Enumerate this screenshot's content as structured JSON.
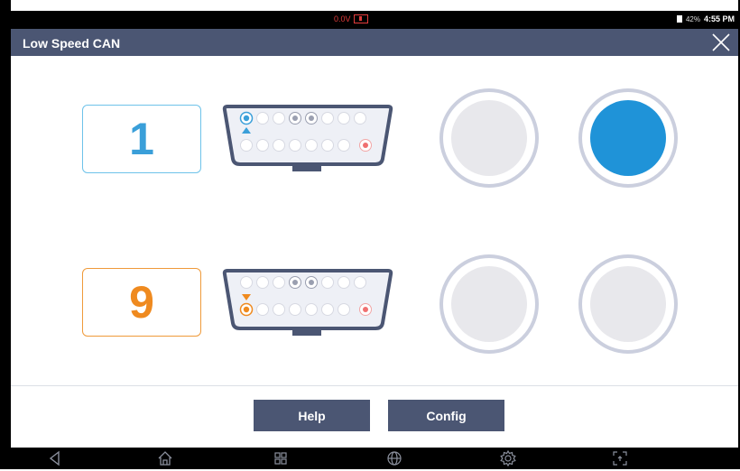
{
  "status_bar": {
    "voltage": "0.0V",
    "battery_percent": "42%",
    "time": "4:55 PM"
  },
  "title_bar": {
    "title": "Low Speed CAN"
  },
  "channels": [
    {
      "pin": "1",
      "color": "#3a9fd9",
      "active_led": "#1f93d8"
    },
    {
      "pin": "9",
      "color": "#ef8a1f"
    }
  ],
  "leds": [
    {
      "state": "off"
    },
    {
      "state": "on"
    },
    {
      "state": "off"
    },
    {
      "state": "off"
    }
  ],
  "buttons": {
    "help": "Help",
    "config": "Config"
  },
  "nav_icons": [
    "back-icon",
    "home-icon",
    "recent-apps-icon",
    "browser-globe-icon",
    "settings-gear-icon",
    "screenshot-icon"
  ],
  "colors": {
    "title_bar": "#4b5673",
    "accent_blue": "#3a9fd9",
    "accent_orange": "#ef8a1f",
    "voltage_red": "#e23b3b"
  }
}
